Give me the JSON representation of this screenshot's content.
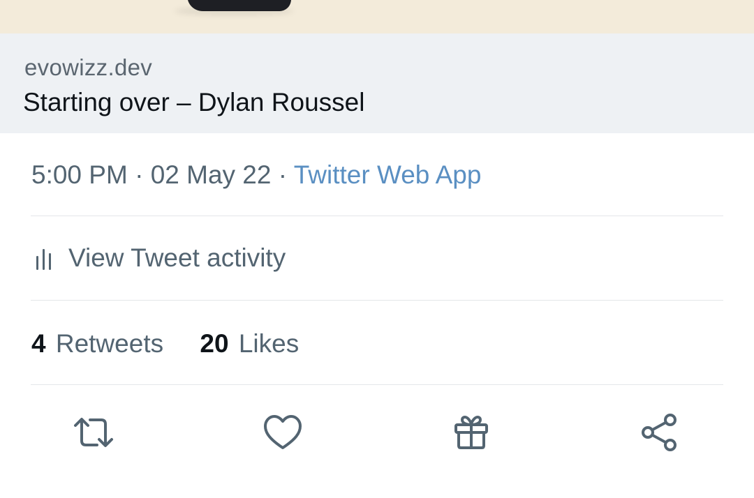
{
  "link_card": {
    "domain": "evowizz.dev",
    "title": "Starting over – Dylan Roussel"
  },
  "tweet_meta": {
    "time": "5:00 PM",
    "separator": "·",
    "date": "02 May 22",
    "source": "Twitter Web App"
  },
  "activity": {
    "icon": "bar-chart-icon",
    "label": "View Tweet activity"
  },
  "stats": {
    "retweets_count": "4",
    "retweets_label": "Retweets",
    "likes_count": "20",
    "likes_label": "Likes"
  },
  "actions": [
    {
      "icon": "retweet-icon"
    },
    {
      "icon": "heart-icon"
    },
    {
      "icon": "gift-icon"
    },
    {
      "icon": "share-icon"
    }
  ],
  "colors": {
    "link": "#5a8fc2",
    "secondary_text": "#536471",
    "primary_text": "#0f1419",
    "card_background": "#eef1f4",
    "icon": "#536471"
  }
}
